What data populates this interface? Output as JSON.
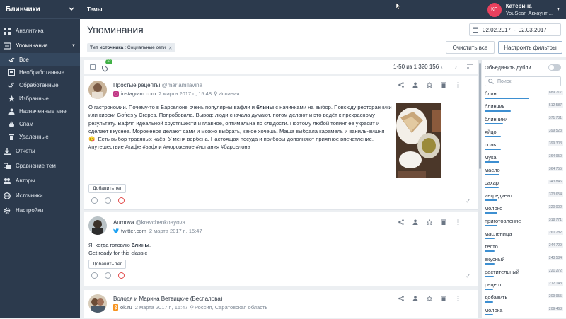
{
  "app": {
    "name": "Блинчики"
  },
  "topbar": {
    "title": "Темы"
  },
  "user": {
    "initials": "КП",
    "name": "Катерина",
    "account": "YouScan Аккаунт ..."
  },
  "sidebar": {
    "items": [
      {
        "label": "Аналитика",
        "icon": "bar-chart-icon"
      },
      {
        "label": "Упоминания",
        "icon": "list-icon"
      },
      {
        "label": "Все",
        "icon": "all-mentions-icon"
      },
      {
        "label": "Необработанные",
        "icon": "inbox-icon"
      },
      {
        "label": "Обработанные",
        "icon": "double-check-icon"
      },
      {
        "label": "Избранные",
        "icon": "star-icon"
      },
      {
        "label": "Назначенные мне",
        "icon": "person-icon"
      },
      {
        "label": "Спам",
        "icon": "flame-icon"
      },
      {
        "label": "Удаленные",
        "icon": "trash-icon"
      },
      {
        "label": "Отчеты",
        "icon": "download-icon"
      },
      {
        "label": "Сравнение тем",
        "icon": "compare-icon"
      },
      {
        "label": "Авторы",
        "icon": "people-icon"
      },
      {
        "label": "Источники",
        "icon": "globe-icon"
      },
      {
        "label": "Настройки",
        "icon": "gear-icon"
      }
    ]
  },
  "header": {
    "title": "Упоминания",
    "date_from": "02.02.2017",
    "date_to": "02.03.2017",
    "filter_key": "Тип источника",
    "filter_value": "Социальные сети",
    "clear_label": "Очистить все",
    "configure_label": "Настроить фильтры"
  },
  "feed": {
    "tag_badge": "32",
    "count": "1-50 из 1 320 156"
  },
  "posts": [
    {
      "author": "Простые рецепты",
      "handle": "@mariamilavina",
      "source": "instagram.com",
      "date": "2 марта 2017 г., 15:48",
      "location": "Испания",
      "segments": [
        {
          "t": "О гастрономии. Почему-то в Барселоне очень популярны вафли и "
        },
        {
          "t": "блины",
          "b": true
        },
        {
          "t": " с начинками на выбор. Повсюду ресторанчики или киоски Gofres y Crepes. Попробовала. Вывод: люди сначала думают, потом делают и это ведёт к прекрасному результату. Вафля идеальной хрустящести и главное, оптимальна по сладости. Поэтому любой топинг её украсит и сделает вкуснее. Мороженое делают сами и можно выбрать, какое хочешь. Маша выбрала карамель и ваниль-вишня 😋. Есть выбор травяных чаёв. У меня вербена. Настоящая посуда и приборы дополняют приятное впечатление. #путешествие #кафе #вафли #мороженое #испания #барселона"
        }
      ],
      "tag_label": "Добавить тег"
    },
    {
      "author": "Aumova",
      "handle": "@kravchenkoayova",
      "source": "twitter.com",
      "date": "2 марта 2017 г., 15:47",
      "segments": [
        {
          "t": "Я, когда готовлю "
        },
        {
          "t": "блины",
          "b": true
        },
        {
          "t": ".\nGet ready for this classic"
        }
      ],
      "tag_label": "Добавить тег"
    },
    {
      "author": "Володя и Марина Ветвицкие (Беспалова)",
      "handle": "",
      "source": "ok.ru",
      "date": "2 марта 2017 г., 15:47",
      "location": "Россия, Саратовская область"
    }
  ],
  "right_panel": {
    "merge_label": "Объединить дубли",
    "search_placeholder": "Поиск",
    "words": [
      {
        "word": "блин",
        "count": "889 717",
        "share": 1.0
      },
      {
        "word": "блинчик",
        "count": "512 587",
        "share": 0.58
      },
      {
        "word": "блинчики",
        "count": "371 731",
        "share": 0.42
      },
      {
        "word": "яйцо",
        "count": "399 523",
        "share": 0.36
      },
      {
        "word": "соль",
        "count": "399 303",
        "share": 0.36
      },
      {
        "word": "мука",
        "count": "364 950",
        "share": 0.33
      },
      {
        "word": "масло",
        "count": "364 755",
        "share": 0.33
      },
      {
        "word": "сахар",
        "count": "343 846",
        "share": 0.31
      },
      {
        "word": "ингредиент",
        "count": "323 654",
        "share": 0.29
      },
      {
        "word": "молоко",
        "count": "320 002",
        "share": 0.29
      },
      {
        "word": "приготовление",
        "count": "318 771",
        "share": 0.29
      },
      {
        "word": "масленица",
        "count": "260 282",
        "share": 0.23
      },
      {
        "word": "тесто",
        "count": "244 729",
        "share": 0.22
      },
      {
        "word": "вкусный",
        "count": "243 584",
        "share": 0.22
      },
      {
        "word": "растительный",
        "count": "221 272",
        "share": 0.2
      },
      {
        "word": "рецепт",
        "count": "212 143",
        "share": 0.19
      },
      {
        "word": "добавить",
        "count": "209 955",
        "share": 0.19
      },
      {
        "word": "молока",
        "count": "209 468",
        "share": 0.19
      }
    ]
  },
  "colors": {
    "sidebar": "#2c3a4d",
    "accent": "#3d8fd1",
    "badge": "#41b146",
    "avatar": "#e9415e"
  }
}
